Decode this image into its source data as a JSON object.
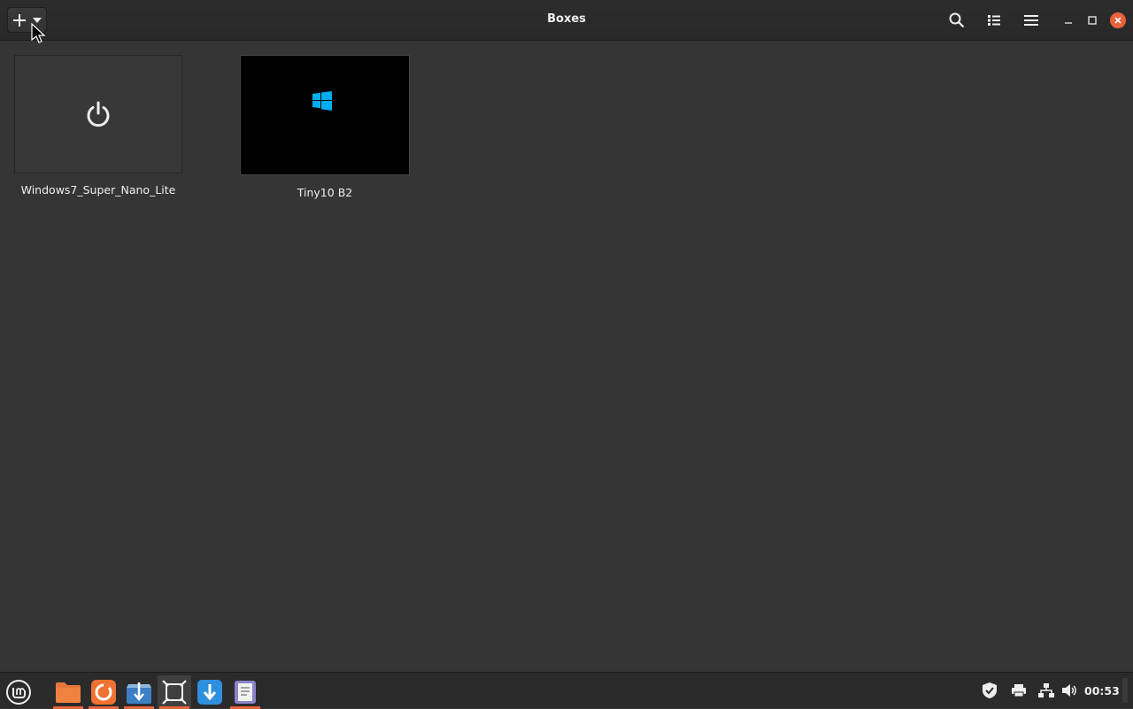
{
  "window": {
    "title": "Boxes"
  },
  "boxes": [
    {
      "name": "Windows7_Super_Nano_Lite",
      "state": "off"
    },
    {
      "name": "Tiny10 B2",
      "state": "running"
    }
  ],
  "taskbar": {
    "clock": "00:53",
    "apps": [
      "menu-icon",
      "files-icon",
      "firefox-icon",
      "software-manager-icon",
      "boxes-icon",
      "update-manager-icon",
      "text-editor-icon"
    ]
  },
  "colors": {
    "accent": "#e8623c",
    "background": "#353535",
    "windows_blue": "#00adef"
  }
}
